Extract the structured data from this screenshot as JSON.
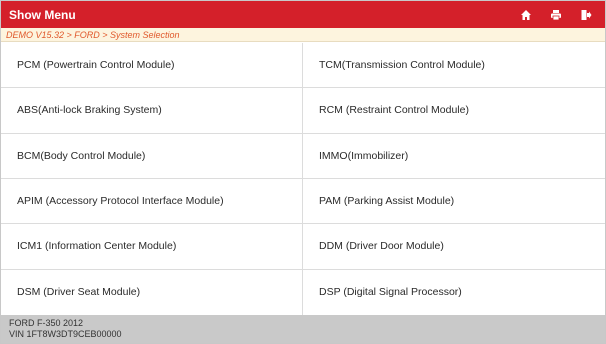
{
  "header": {
    "title": "Show Menu",
    "accent_color": "#d4202a",
    "buttons": [
      {
        "icon": "home-icon"
      },
      {
        "icon": "print-icon"
      },
      {
        "icon": "exit-icon"
      }
    ]
  },
  "breadcrumb": "DEMO V15.32 > FORD > System Selection",
  "systems": [
    "PCM (Powertrain Control Module)",
    "TCM(Transmission Control Module)",
    "ABS(Anti-lock Braking System)",
    "RCM (Restraint Control Module)",
    "BCM(Body Control Module)",
    "IMMO(Immobilizer)",
    "APIM (Accessory Protocol Interface Module)",
    "PAM (Parking Assist Module)",
    "ICM1 (Information Center Module)",
    "DDM (Driver Door Module)",
    "DSM (Driver Seat Module)",
    "DSP (Digital Signal Processor)"
  ],
  "vehicle": {
    "model": "FORD F-350 2012",
    "vin": "VIN 1FT8W3DT9CEB00000"
  }
}
